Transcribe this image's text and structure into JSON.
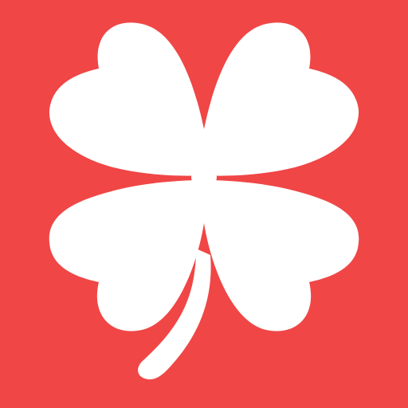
{
  "icon": {
    "name": "four-leaf-clover-icon",
    "background_color": "#f04646",
    "foreground_color": "#ffffff"
  }
}
